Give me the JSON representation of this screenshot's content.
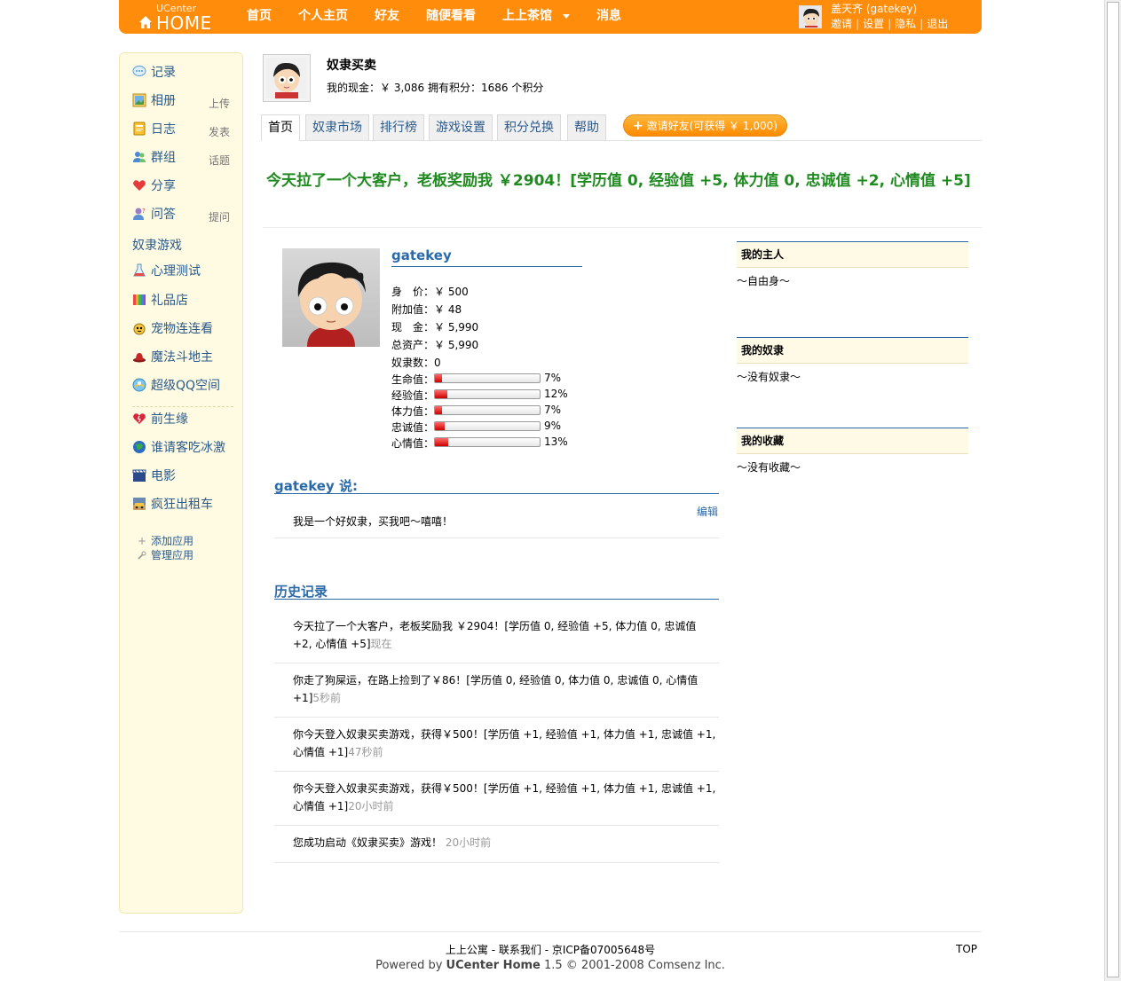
{
  "header": {
    "logo_top": "UCenter",
    "logo_main": "HOME",
    "nav": [
      "首页",
      "个人主页",
      "好友",
      "随便看看",
      "上上茶馆",
      "消息"
    ],
    "username": "盖天齐 (gatekey)",
    "links": [
      "邀请",
      "设置",
      "隐私",
      "退出"
    ]
  },
  "sidebar": {
    "items": [
      {
        "label": "记录",
        "side": "",
        "icon": "speech-bubble-icon"
      },
      {
        "label": "相册",
        "side": "上传",
        "icon": "photo-icon"
      },
      {
        "label": "日志",
        "side": "发表",
        "icon": "notebook-icon"
      },
      {
        "label": "群组",
        "side": "话题",
        "icon": "group-icon"
      },
      {
        "label": "分享",
        "side": "",
        "icon": "heart-icon"
      },
      {
        "label": "问答",
        "side": "提问",
        "icon": "question-icon"
      }
    ],
    "section_title": "奴隶游戏",
    "apps": [
      "心理测试",
      "礼品店",
      "宠物连连看",
      "魔法斗地主",
      "超级QQ空间"
    ],
    "apps2": [
      "前生缘",
      "谁请客吃冰激",
      "电影",
      "疯狂出租车"
    ],
    "add_app": "添加应用",
    "manage_app": "管理应用"
  },
  "app": {
    "title": "奴隶买卖",
    "stats": "我的现金：￥ 3,086 拥有积分：1686 个积分",
    "tabs": [
      "首页",
      "奴隶市场",
      "排行榜",
      "游戏设置",
      "积分兑换",
      "帮助"
    ],
    "invite": "邀请好友(可获得 ￥ 1,000)",
    "notice": "今天拉了一个大客户，老板奖励我 ￥2904！[学历值 0, 经验值 +5, 体力值 0, 忠诚值 +2, 心情值 +5]"
  },
  "profile": {
    "name": "gatekey",
    "stats": [
      {
        "label": "身　价：",
        "value": "￥ 500"
      },
      {
        "label": "附加值：",
        "value": "￥ 48"
      },
      {
        "label": "现　金：",
        "value": "￥ 5,990"
      },
      {
        "label": "总资产：",
        "value": "￥ 5,990"
      },
      {
        "label": "奴隶数：",
        "value": "0"
      }
    ],
    "bars": [
      {
        "label": "生命值：",
        "percent": 7,
        "text": "7%"
      },
      {
        "label": "经验值：",
        "percent": 12,
        "text": "12%"
      },
      {
        "label": "体力值：",
        "percent": 7,
        "text": "7%"
      },
      {
        "label": "忠诚值：",
        "percent": 9,
        "text": "9%"
      },
      {
        "label": "心情值：",
        "percent": 13,
        "text": "13%"
      }
    ]
  },
  "says": {
    "title": "gatekey 说:",
    "edit": "编辑",
    "text": "我是一个好奴隶，买我吧～嘻嘻！"
  },
  "history": {
    "title": "历史记录",
    "items": [
      {
        "text": "今天拉了一个大客户，老板奖励我 ￥2904！[学历值 0, 经验值 +5, 体力值 0, 忠诚值 +2, 心情值 +5]",
        "time": "现在"
      },
      {
        "text": "你走了狗屎运，在路上捡到了￥86！[学历值 0, 经验值 0, 体力值 0, 忠诚值 0, 心情值 +1]",
        "time": "5秒前"
      },
      {
        "text": "你今天登入奴隶买卖游戏，获得￥500！[学历值 +1, 经验值 +1, 体力值 +1, 忠诚值 +1, 心情值 +1]",
        "time": "47秒前"
      },
      {
        "text": "你今天登入奴隶买卖游戏，获得￥500！[学历值 +1, 经验值 +1, 体力值 +1, 忠诚值 +1, 心情值 +1]",
        "time": "20小时前"
      },
      {
        "text": "您成功启动《奴隶买卖》游戏！",
        "time": "20小时前"
      }
    ]
  },
  "right": [
    {
      "title": "我的主人",
      "body": "～自由身～"
    },
    {
      "title": "我的奴隶",
      "body": "～没有奴隶～"
    },
    {
      "title": "我的收藏",
      "body": "～没有收藏～"
    }
  ],
  "footer": {
    "line1": "上上公寓 - 联系我们 - 京ICP备07005648号",
    "powered": "Powered by ",
    "brand": "UCenter Home",
    "rest": " 1.5 © 2001-2008 Comsenz Inc.",
    "top": "TOP"
  }
}
